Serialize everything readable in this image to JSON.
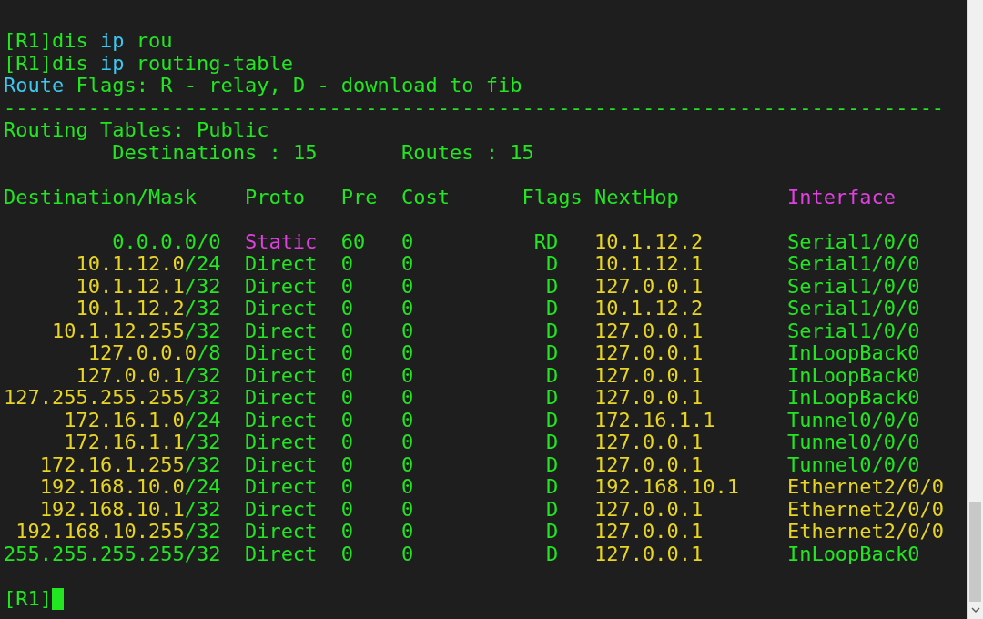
{
  "commands": [
    {
      "segments": [
        {
          "text": "[R1]dis ",
          "color": "#22e622"
        },
        {
          "text": "ip",
          "color": "#3cc8f0"
        },
        {
          "text": " rou",
          "color": "#22e622"
        }
      ]
    },
    {
      "segments": [
        {
          "text": "[R1]dis ",
          "color": "#22e622"
        },
        {
          "text": "ip",
          "color": "#3cc8f0"
        },
        {
          "text": " routing-table",
          "color": "#22e622"
        }
      ]
    },
    {
      "segments": [
        {
          "text": "Route",
          "color": "#3cc8f0"
        },
        {
          "text": " Flags: R - relay, D - download to fib",
          "color": "#22e622"
        }
      ]
    }
  ],
  "separator": "------------------------------------------------------------------------------",
  "table_title": "Routing Tables: Public",
  "summary": [
    "Destinations : 15",
    "Routes : 15"
  ],
  "columns": [
    {
      "label": "Destination/Mask",
      "color": "#22e622"
    },
    {
      "label": "Proto",
      "color": "#22e622"
    },
    {
      "label": "Pre",
      "color": "#22e622"
    },
    {
      "label": "Cost",
      "color": "#22e622"
    },
    {
      "label": "Flags",
      "color": "#22e622"
    },
    {
      "label": "NextHop",
      "color": "#22e622"
    },
    {
      "label": "Interface",
      "color": "#e040e0"
    }
  ],
  "rows": [
    {
      "address": {
        "text": "0.0.0.0",
        "color": "#22e622"
      },
      "mask": "/0",
      "proto": {
        "text": "Static",
        "color": "#e040e0"
      },
      "pre": "60",
      "cost": "0",
      "flags": "RD",
      "nexthop": "10.1.12.2",
      "interface": {
        "text": "Serial1/0/0",
        "color": "#22e622"
      }
    },
    {
      "address": {
        "text": "10.1.12.0",
        "color": "#e8d424"
      },
      "mask": "/24",
      "proto": {
        "text": "Direct",
        "color": "#22e622"
      },
      "pre": "0",
      "cost": "0",
      "flags": "D",
      "nexthop": "10.1.12.1",
      "interface": {
        "text": "Serial1/0/0",
        "color": "#22e622"
      }
    },
    {
      "address": {
        "text": "10.1.12.1",
        "color": "#e8d424"
      },
      "mask": "/32",
      "proto": {
        "text": "Direct",
        "color": "#22e622"
      },
      "pre": "0",
      "cost": "0",
      "flags": "D",
      "nexthop": "127.0.0.1",
      "interface": {
        "text": "Serial1/0/0",
        "color": "#22e622"
      }
    },
    {
      "address": {
        "text": "10.1.12.2",
        "color": "#e8d424"
      },
      "mask": "/32",
      "proto": {
        "text": "Direct",
        "color": "#22e622"
      },
      "pre": "0",
      "cost": "0",
      "flags": "D",
      "nexthop": "10.1.12.2",
      "interface": {
        "text": "Serial1/0/0",
        "color": "#22e622"
      }
    },
    {
      "address": {
        "text": "10.1.12.255",
        "color": "#e8d424"
      },
      "mask": "/32",
      "proto": {
        "text": "Direct",
        "color": "#22e622"
      },
      "pre": "0",
      "cost": "0",
      "flags": "D",
      "nexthop": "127.0.0.1",
      "interface": {
        "text": "Serial1/0/0",
        "color": "#22e622"
      }
    },
    {
      "address": {
        "text": "127.0.0.0",
        "color": "#e8d424"
      },
      "mask": "/8",
      "proto": {
        "text": "Direct",
        "color": "#22e622"
      },
      "pre": "0",
      "cost": "0",
      "flags": "D",
      "nexthop": "127.0.0.1",
      "interface": {
        "text": "InLoopBack0",
        "color": "#22e622"
      }
    },
    {
      "address": {
        "text": "127.0.0.1",
        "color": "#e8d424"
      },
      "mask": "/32",
      "proto": {
        "text": "Direct",
        "color": "#22e622"
      },
      "pre": "0",
      "cost": "0",
      "flags": "D",
      "nexthop": "127.0.0.1",
      "interface": {
        "text": "InLoopBack0",
        "color": "#22e622"
      }
    },
    {
      "address": {
        "text": "127.255.255.255",
        "color": "#e8d424"
      },
      "mask": "/32",
      "proto": {
        "text": "Direct",
        "color": "#22e622"
      },
      "pre": "0",
      "cost": "0",
      "flags": "D",
      "nexthop": "127.0.0.1",
      "interface": {
        "text": "InLoopBack0",
        "color": "#22e622"
      }
    },
    {
      "address": {
        "text": "172.16.1.0",
        "color": "#e8d424"
      },
      "mask": "/24",
      "proto": {
        "text": "Direct",
        "color": "#22e622"
      },
      "pre": "0",
      "cost": "0",
      "flags": "D",
      "nexthop": "172.16.1.1",
      "interface": {
        "text": "Tunnel0/0/0",
        "color": "#22e622"
      }
    },
    {
      "address": {
        "text": "172.16.1.1",
        "color": "#e8d424"
      },
      "mask": "/32",
      "proto": {
        "text": "Direct",
        "color": "#22e622"
      },
      "pre": "0",
      "cost": "0",
      "flags": "D",
      "nexthop": "127.0.0.1",
      "interface": {
        "text": "Tunnel0/0/0",
        "color": "#22e622"
      }
    },
    {
      "address": {
        "text": "172.16.1.255",
        "color": "#e8d424"
      },
      "mask": "/32",
      "proto": {
        "text": "Direct",
        "color": "#22e622"
      },
      "pre": "0",
      "cost": "0",
      "flags": "D",
      "nexthop": "127.0.0.1",
      "interface": {
        "text": "Tunnel0/0/0",
        "color": "#22e622"
      }
    },
    {
      "address": {
        "text": "192.168.10.0",
        "color": "#e8d424"
      },
      "mask": "/24",
      "proto": {
        "text": "Direct",
        "color": "#22e622"
      },
      "pre": "0",
      "cost": "0",
      "flags": "D",
      "nexthop": "192.168.10.1",
      "interface": {
        "text": "Ethernet2/0/0",
        "color": "#e8d424"
      }
    },
    {
      "address": {
        "text": "192.168.10.1",
        "color": "#e8d424"
      },
      "mask": "/32",
      "proto": {
        "text": "Direct",
        "color": "#22e622"
      },
      "pre": "0",
      "cost": "0",
      "flags": "D",
      "nexthop": "127.0.0.1",
      "interface": {
        "text": "Ethernet2/0/0",
        "color": "#e8d424"
      }
    },
    {
      "address": {
        "text": "192.168.10.255",
        "color": "#e8d424"
      },
      "mask": "/32",
      "proto": {
        "text": "Direct",
        "color": "#22e622"
      },
      "pre": "0",
      "cost": "0",
      "flags": "D",
      "nexthop": "127.0.0.1",
      "interface": {
        "text": "Ethernet2/0/0",
        "color": "#e8d424"
      }
    },
    {
      "address": {
        "text": "255.255.255.255",
        "color": "#22e622"
      },
      "mask": "/32",
      "proto": {
        "text": "Direct",
        "color": "#22e622"
      },
      "pre": "0",
      "cost": "0",
      "flags": "D",
      "nexthop": "127.0.0.1",
      "interface": {
        "text": "InLoopBack0",
        "color": "#22e622"
      }
    }
  ],
  "prompt": "[R1]"
}
